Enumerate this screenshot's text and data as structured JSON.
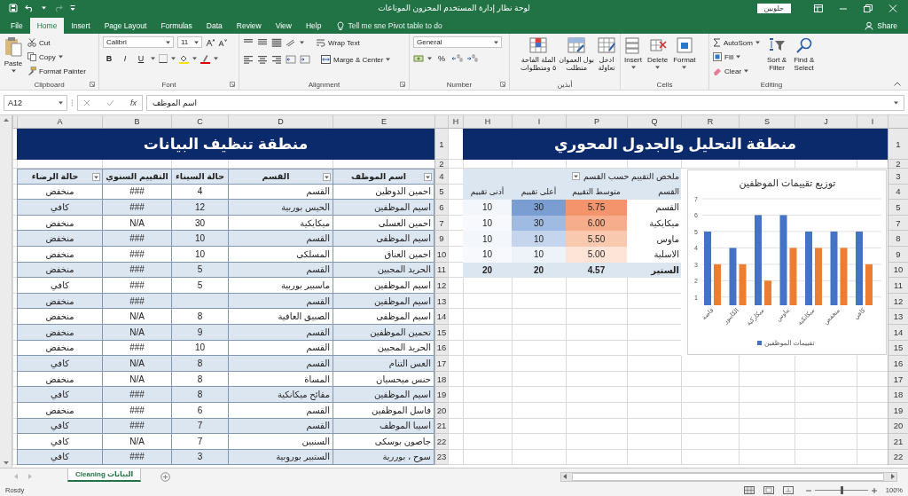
{
  "window": {
    "title": "لوحة نظار إدارة المستخدم المحزون الموناعات",
    "account": "حلوبين"
  },
  "ribbon_tabs": [
    {
      "label": "Help",
      "selected": false
    },
    {
      "label": "View",
      "selected": false
    },
    {
      "label": "Review",
      "selected": false
    },
    {
      "label": "Data",
      "selected": false
    },
    {
      "label": "Formulas",
      "selected": false
    },
    {
      "label": "Page Layout",
      "selected": false
    },
    {
      "label": "Insert",
      "selected": false
    },
    {
      "label": "Home",
      "selected": true
    },
    {
      "label": "File",
      "selected": false
    }
  ],
  "tell_me": "Tell me sne Pivot table to do",
  "share": "Share",
  "ribbon": {
    "clipboard": {
      "label": "Clipboard",
      "paste": "Paste",
      "cut": "Cut",
      "copy": "Copy",
      "format_painter": "Format Painter"
    },
    "font": {
      "label": "Font",
      "font_name": "Calibri",
      "font_size": "11",
      "bold": "B",
      "italic": "I",
      "underline": "U"
    },
    "alignment": {
      "label": "Alignment",
      "wrap_text": "Wrap Text",
      "merge_center": "Marge & Center"
    },
    "number": {
      "label": "Number",
      "format": "General",
      "percent": "%"
    },
    "styles": {
      "label": "أبذين",
      "conditional": "الملة الفاحة\n٥ ومتطلوات",
      "format_table": "بول العموان\nمتطلت",
      "cell_styles": "ادخل\nتعاولة"
    },
    "cells": {
      "label": "Cells",
      "insert": "Insert",
      "delete": "Delete",
      "format": "Format"
    },
    "editing": {
      "label": "Editing",
      "autosum": "AutoSom",
      "fill": "Fill",
      "clear": "Clear",
      "sort_filter": "Sort &\nFilter",
      "find_select": "Find &\nSelect"
    }
  },
  "formula_bar": {
    "name_box": "A12",
    "function_button": "fx",
    "formula": "اسم الموظف"
  },
  "left_pane": {
    "columns": [
      "E",
      "D",
      "C",
      "B",
      "A"
    ],
    "banner": "منطقة تنظيف البيانات",
    "banner_row": "1",
    "spacer_row": "2",
    "header_row": "4",
    "headers": [
      {
        "label": "اسم الموظف",
        "filter": true
      },
      {
        "label": "القسم",
        "filter": true
      },
      {
        "label": "حالة السيناء",
        "filter": false
      },
      {
        "label": "التقييم السنوي",
        "filter": false
      },
      {
        "label": "حالة الرضاء",
        "filter": true
      }
    ],
    "rows": [
      {
        "row": "5",
        "cells": [
          "احمين الدوظين",
          "القسم",
          "4",
          "###",
          "منخفض"
        ]
      },
      {
        "row": "6",
        "cells": [
          "اسيم الموظفين",
          "الحيس بوربية",
          "12",
          "###",
          "كافي"
        ]
      },
      {
        "row": "7",
        "cells": [
          "احمين العسلى",
          "ميكايكية",
          "30",
          "N/A",
          "منخفض"
        ]
      },
      {
        "row": "9",
        "cells": [
          "اسيم الموظفى",
          "القسم",
          "10",
          "###",
          "منخفض"
        ]
      },
      {
        "row": "10",
        "cells": [
          "احمين العناق",
          "المسلكى",
          "10",
          "###",
          "منخفض"
        ]
      },
      {
        "row": "11",
        "cells": [
          "الحريد المجبين",
          "القسم",
          "5",
          "###",
          "منخفض"
        ]
      },
      {
        "row": "12",
        "cells": [
          "اسيم الموظفين",
          "ماسبير بوربية",
          "5",
          "###",
          "كافي"
        ]
      },
      {
        "row": "13",
        "cells": [
          "اسيم الموظفين",
          "القسم",
          "",
          "###",
          "منخفض"
        ]
      },
      {
        "row": "14",
        "cells": [
          "اسيم الموظفى",
          "الصبيق العافية",
          "8",
          "N/A",
          "منخفض"
        ]
      },
      {
        "row": "15",
        "cells": [
          "تحمين الموظفين",
          "القسم",
          "9",
          "N/A",
          "منخفض"
        ]
      },
      {
        "row": "16",
        "cells": [
          "الحريد المجبين",
          "القسم",
          "10",
          "###",
          "منخفض"
        ]
      },
      {
        "row": "17",
        "cells": [
          "العس التنام",
          "القسم",
          "8",
          "N/A",
          "كافي"
        ]
      },
      {
        "row": "18",
        "cells": [
          "حنس ميحسيان",
          "المساة",
          "8",
          "N/A",
          "منخفض"
        ]
      },
      {
        "row": "19",
        "cells": [
          "اسيم الموظفين",
          "مقائح ميكانكية",
          "8",
          "###",
          "كافي"
        ]
      },
      {
        "row": "20",
        "cells": [
          "فاسل الموظفين",
          "القسم",
          "6",
          "###",
          "منخفض"
        ]
      },
      {
        "row": "21",
        "cells": [
          "اسيبا الموظف",
          "القسم",
          "7",
          "###",
          "كافي"
        ]
      },
      {
        "row": "22",
        "cells": [
          "جاصون بوسكى",
          "السنبين",
          "7",
          "N/A",
          "كافي"
        ]
      },
      {
        "row": "23",
        "cells": [
          "سوح ، بوررية",
          "الستبير بوروبية",
          "3",
          "###",
          "كافي"
        ]
      }
    ]
  },
  "right_pane": {
    "columns": [
      "I",
      "J",
      "S",
      "R",
      "Q",
      "P",
      "I",
      "H",
      "H"
    ],
    "banner": "منطقة التحليل والجدول المحوري",
    "row_labels": [
      "1",
      "2",
      "3",
      "4",
      "5",
      "7",
      "8",
      "9",
      "10",
      "11",
      "12",
      "13",
      "14",
      "15",
      "16",
      "17",
      "18",
      "19",
      "20",
      "21",
      "22"
    ],
    "pivot": {
      "title": "ملخص التقييم حسب القسم",
      "headers": [
        "القسم",
        "متوسط التقييم",
        "أعلى تقييم",
        "أدنى تقييم"
      ],
      "rows": [
        {
          "label": "القسم",
          "cells": [
            {
              "value": "5.75",
              "color": "#f3946c"
            },
            {
              "value": "30",
              "color": "#7a9dd2"
            },
            {
              "value": "10",
              "color": "#f3f6fb"
            }
          ]
        },
        {
          "label": "ميكايكية",
          "cells": [
            {
              "value": "6.00",
              "color": "#f6ad8c"
            },
            {
              "value": "30",
              "color": "#a0bbe1"
            },
            {
              "value": "10",
              "color": "#f7f9fc"
            }
          ]
        },
        {
          "label": "ماوس",
          "cells": [
            {
              "value": "5.50",
              "color": "#f9c9af"
            },
            {
              "value": "10",
              "color": "#c5d5ed"
            },
            {
              "value": "10",
              "color": "#f3f6fb"
            }
          ]
        },
        {
          "label": "الاسلية",
          "cells": [
            {
              "value": "5.00",
              "color": "#fde4d6"
            },
            {
              "value": "10",
              "color": "#eef3fa"
            },
            {
              "value": "10",
              "color": "#f7f9fc"
            }
          ]
        }
      ],
      "total": {
        "label": "الستير",
        "cells": [
          "4.57",
          "20",
          "20"
        ]
      }
    },
    "chart_data": {
      "type": "bar",
      "title": "توزيع تقييمات الموظفين",
      "categories": [
        "قاصة",
        "الكايبوز",
        "ميكاركية",
        "ماوس",
        "ميكانكية",
        "منخفض",
        "كافي"
      ],
      "series": [
        {
          "name": "تقييمات الموظفين",
          "color": "#4472c4",
          "values": [
            5,
            4,
            6,
            6,
            5,
            5,
            5
          ]
        },
        {
          "color": "#ed7d31",
          "values": [
            3,
            3,
            2,
            4,
            4,
            4,
            3
          ]
        }
      ],
      "ylim": [
        0.5,
        7
      ],
      "yticks": [
        1,
        2,
        3,
        4,
        5,
        6,
        7
      ],
      "grid": true
    }
  },
  "sheet_tabs": [
    {
      "label": "البيانات Cleaning",
      "selected": true
    }
  ],
  "status_bar": {
    "text": "Rosdy",
    "zoom_slider": {
      "level": 0.5
    },
    "zoom": "100%"
  }
}
